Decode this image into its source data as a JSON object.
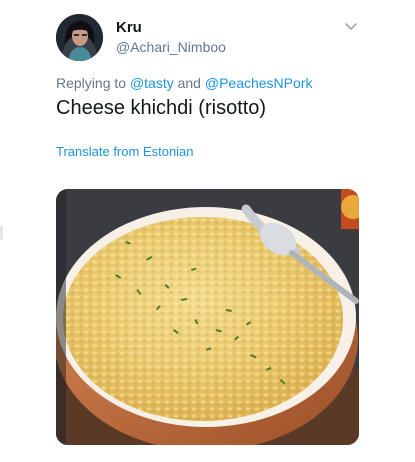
{
  "user": {
    "display_name": "Kru",
    "handle": "@Achari_Nimboo"
  },
  "reply": {
    "prefix": "Replying to",
    "mention1": "@tasty",
    "conjunction": "and",
    "mention2": "@PeachesNPork"
  },
  "tweet": {
    "text": "Cheese khichdi (risotto)",
    "translate_label": "Translate from Estonian"
  },
  "icons": {
    "menu": "chevron-down-icon"
  },
  "colors": {
    "link": "#1b95e0",
    "secondary_text": "#657786",
    "primary_text": "#14171a"
  }
}
